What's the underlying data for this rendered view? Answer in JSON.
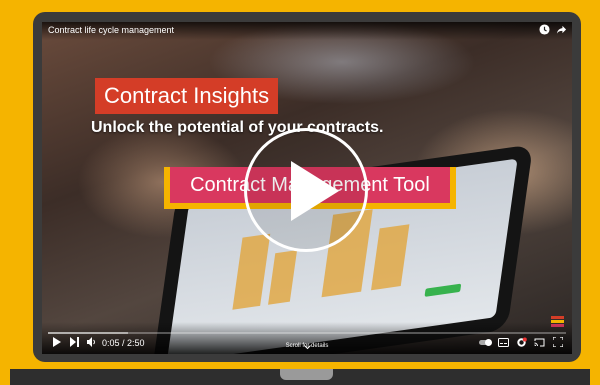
{
  "video": {
    "title": "Contract life cycle management",
    "heading": "Contract Insights",
    "subheading": "Unlock the potential of your contracts.",
    "tool_label": "Contract Management Tool",
    "time_display": "0:05 / 2:50",
    "scroll_hint": "Scroll for details",
    "progress_fraction": 0.0
  },
  "icons": {
    "clock": "clock-icon",
    "share": "share-icon",
    "play": "play-icon",
    "next": "next-icon",
    "volume": "volume-icon",
    "autoplay": "autoplay-toggle",
    "subtitles": "subtitles-icon",
    "settings": "settings-icon",
    "cast": "cast-icon",
    "fullscreen": "fullscreen-icon",
    "chevron": "chevron-down-icon"
  },
  "colors": {
    "background": "#f5b400",
    "heading_box": "#d43d27",
    "tool_box": "#d9385f",
    "progress": "#ff0000"
  }
}
